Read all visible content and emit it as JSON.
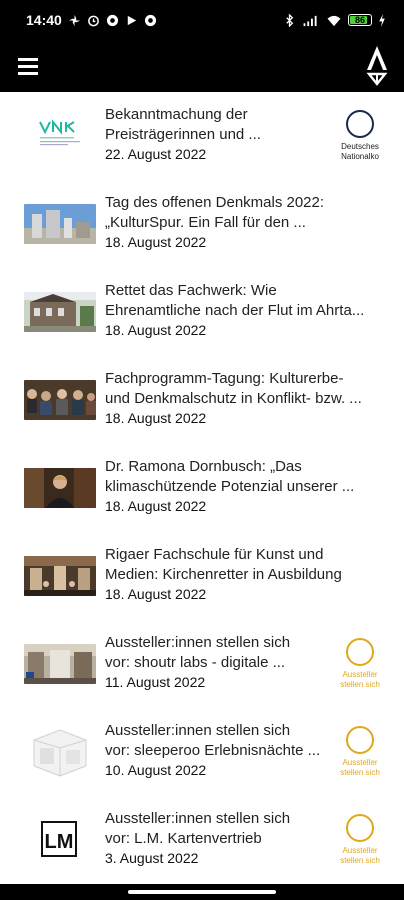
{
  "status_bar": {
    "time": "14:40",
    "battery": "86",
    "battery_level": 0.86,
    "left_icons": [
      "fan-icon",
      "alarm-icon",
      "record-icon",
      "play-icon",
      "record-icon"
    ],
    "right_icons": [
      "bluetooth-icon",
      "signal-icon",
      "wifi-icon",
      "battery-icon",
      "charging-icon"
    ]
  },
  "app_bar": {
    "menu_icon": "hamburger-menu-icon",
    "logo_icon": "app-logo-icon"
  },
  "items": [
    {
      "title_line1": "Bekanntmachung der",
      "title_line2": "Preisträgerinnen und ...",
      "date": "22. August 2022",
      "badge": "Deutsches Nationalko",
      "badge_color": "#1a2a4a"
    },
    {
      "title_line1": "Tag des offenen Denkmals 2022:",
      "title_line2": "„KulturSpur. Ein Fall für den ...",
      "date": "18. August 2022"
    },
    {
      "title_line1": "Rettet das Fachwerk: Wie",
      "title_line2": "Ehrenamtliche nach der Flut im Ahrta...",
      "date": "18. August 2022"
    },
    {
      "title_line1": "Fachprogramm-Tagung: Kulturerbe-",
      "title_line2": "und Denkmalschutz in Konflikt- bzw. ...",
      "date": "18. August 2022"
    },
    {
      "title_line1": "Dr. Ramona Dornbusch: „Das",
      "title_line2": "klimaschützende Potenzial unserer ...",
      "date": "18. August 2022"
    },
    {
      "title_line1": "Rigaer Fachschule für Kunst und",
      "title_line2": "Medien: Kirchenretter in Ausbildung",
      "date": "18. August 2022"
    },
    {
      "title_line1": "Aussteller:innen stellen sich",
      "title_line2": "vor: shoutr labs - digitale ...",
      "date": "11. August 2022",
      "badge": "Aussteller stellen sich",
      "badge_color": "#e0a81c"
    },
    {
      "title_line1": "Aussteller:innen stellen sich",
      "title_line2": "vor: sleeperoo Erlebnisnächte ...",
      "date": "10. August 2022",
      "badge": "Aussteller stellen sich",
      "badge_color": "#e0a81c"
    },
    {
      "title_line1": "Aussteller:innen stellen sich",
      "title_line2": "vor: L.M. Kartenvertrieb",
      "date": "3. August 2022",
      "badge": "Aussteller stellen sich",
      "badge_color": "#e0a81c"
    }
  ],
  "thumbs": {
    "item0_logo_text": "VNK",
    "item8_logo_text": "LM"
  }
}
